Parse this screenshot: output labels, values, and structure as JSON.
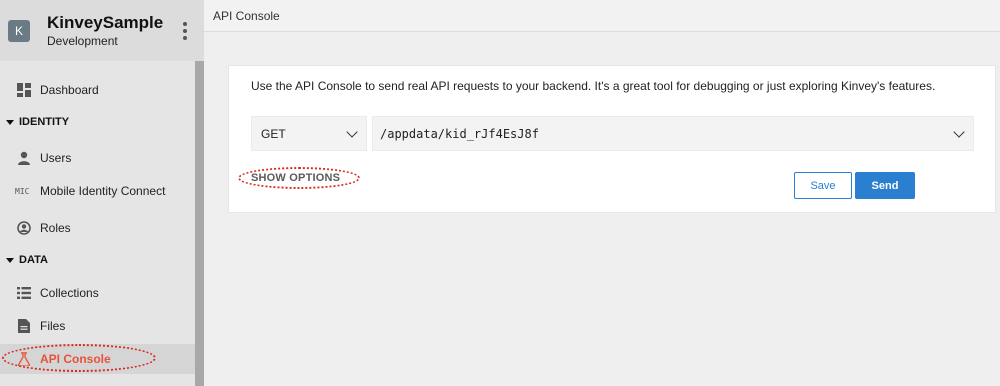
{
  "app": {
    "avatar_letter": "K",
    "name": "KinveySample",
    "environment": "Development"
  },
  "sidebar": {
    "items": [
      {
        "label": "Dashboard",
        "icon": "dashboard-icon"
      },
      {
        "section": "IDENTITY"
      },
      {
        "label": "Users",
        "icon": "user-icon"
      },
      {
        "label": "Mobile Identity Connect",
        "icon": "mic-icon",
        "icon_text": "MIC"
      },
      {
        "label": "Roles",
        "icon": "roles-icon"
      },
      {
        "section": "DATA"
      },
      {
        "label": "Collections",
        "icon": "list-icon"
      },
      {
        "label": "Files",
        "icon": "file-icon"
      },
      {
        "label": "API Console",
        "icon": "flask-icon",
        "active": true
      }
    ]
  },
  "main": {
    "title": "API Console",
    "description": "Use the API Console to send real API requests to your backend. It's a great tool for debugging or just exploring Kinvey's features.",
    "method": "GET",
    "url": "/appdata/kid_rJf4EsJ8f",
    "show_options_label": "SHOW OPTIONS",
    "save_label": "Save",
    "send_label": "Send"
  },
  "colors": {
    "accent": "#e8513b",
    "primary_button": "#2a7fd0",
    "annotation": "#d8281e"
  }
}
